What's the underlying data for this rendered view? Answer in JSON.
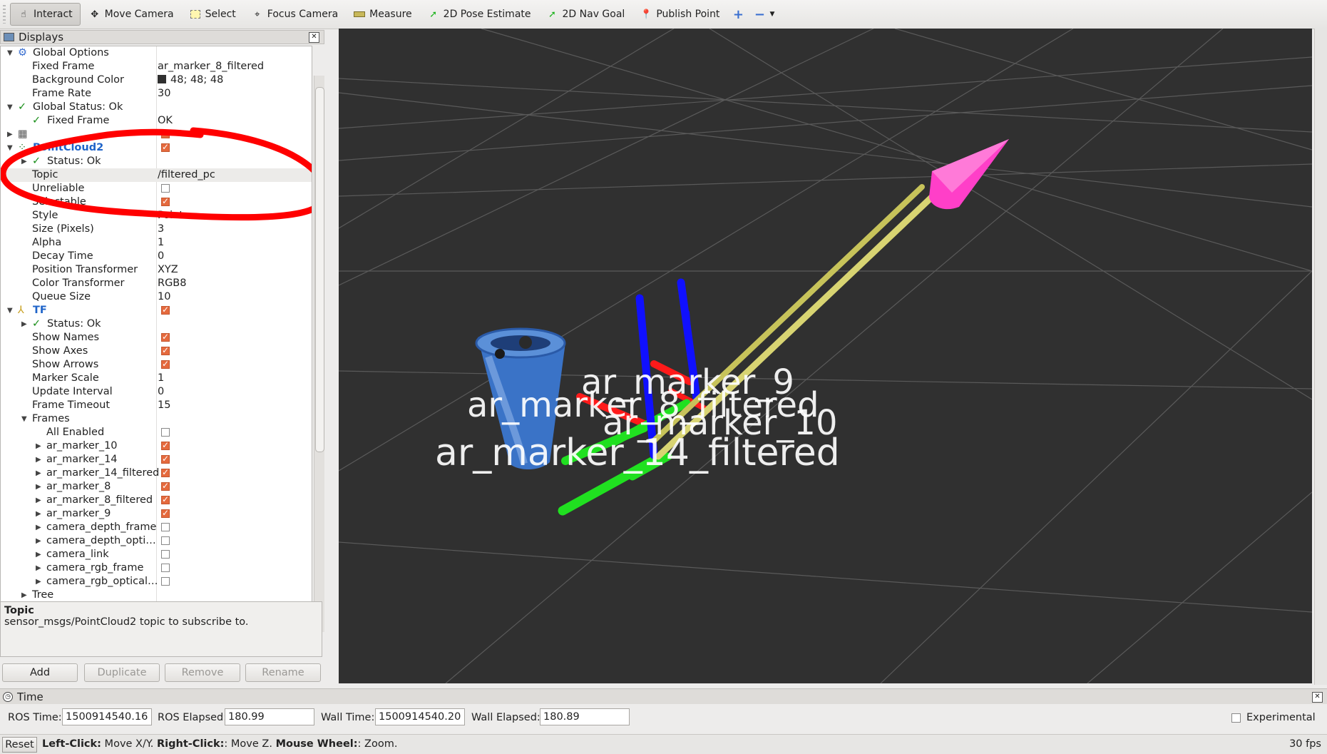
{
  "toolbar": {
    "interact": "Interact",
    "move_camera": "Move Camera",
    "select": "Select",
    "focus_camera": "Focus Camera",
    "measure": "Measure",
    "pose_estimate": "2D Pose Estimate",
    "nav_goal": "2D Nav Goal",
    "publish_point": "Publish Point"
  },
  "displays": {
    "title": "Displays",
    "rows": {
      "global_options": "Global Options",
      "fixed_frame_label": "Fixed Frame",
      "fixed_frame_value": "ar_marker_8_filtered",
      "bg_color_label": "Background Color",
      "bg_color_value": "48; 48; 48",
      "frame_rate_label": "Frame Rate",
      "frame_rate_value": "30",
      "global_status": "Global Status: Ok",
      "gs_fixed_frame": "Fixed Frame",
      "gs_fixed_frame_value": "OK",
      "pointcloud2": "PointCloud2",
      "pc_status": "Status: Ok",
      "topic_label": "Topic",
      "topic_value": "/filtered_pc",
      "unreliable_label": "Unreliable",
      "selectable_label": "Selectable",
      "style_label": "Style",
      "style_value": "Points",
      "size_label": "Size (Pixels)",
      "size_value": "3",
      "alpha_label": "Alpha",
      "alpha_value": "1",
      "decay_label": "Decay Time",
      "decay_value": "0",
      "pos_tf_label": "Position Transformer",
      "pos_tf_value": "XYZ",
      "color_tf_label": "Color Transformer",
      "color_tf_value": "RGB8",
      "queue_label": "Queue Size",
      "queue_value": "10",
      "tf": "TF",
      "tf_status": "Status: Ok",
      "show_names": "Show Names",
      "show_axes": "Show Axes",
      "show_arrows": "Show Arrows",
      "marker_scale_label": "Marker Scale",
      "marker_scale_value": "1",
      "update_interval_label": "Update Interval",
      "update_interval_value": "0",
      "frame_timeout_label": "Frame Timeout",
      "frame_timeout_value": "15",
      "frames": "Frames",
      "all_enabled": "All Enabled",
      "tree": "Tree"
    },
    "frames": [
      {
        "name": "ar_marker_10",
        "on": true
      },
      {
        "name": "ar_marker_14",
        "on": true
      },
      {
        "name": "ar_marker_14_filtered",
        "on": true
      },
      {
        "name": "ar_marker_8",
        "on": true
      },
      {
        "name": "ar_marker_8_filtered",
        "on": true
      },
      {
        "name": "ar_marker_9",
        "on": true
      },
      {
        "name": "camera_depth_frame",
        "on": false
      },
      {
        "name": "camera_depth_opti…",
        "on": false
      },
      {
        "name": "camera_link",
        "on": false
      },
      {
        "name": "camera_rgb_frame",
        "on": false
      },
      {
        "name": "camera_rgb_optical…",
        "on": false
      }
    ]
  },
  "description": {
    "title": "Topic",
    "text": "sensor_msgs/PointCloud2 topic to subscribe to."
  },
  "buttons": {
    "add": "Add",
    "duplicate": "Duplicate",
    "remove": "Remove",
    "rename": "Rename"
  },
  "viewport": {
    "labels": [
      "ar_marker_9",
      "ar_marker_8_filtered",
      "ar_marker_10",
      "ar_marker_14_filtered"
    ],
    "colors": {
      "background": "#303030",
      "x_axis": "#ff0000",
      "y_axis": "#00ff00",
      "z_axis": "#0000ff",
      "arrow": "#d4d060",
      "arrow_head": "#ff3fc8",
      "annotation": "#ff0000"
    }
  },
  "time": {
    "title": "Time",
    "ros_time_label": "ROS Time:",
    "ros_time_value": "1500914540.16",
    "ros_elapsed_label": "ROS Elapsed:",
    "ros_elapsed_value": "180.99",
    "wall_time_label": "Wall Time:",
    "wall_time_value": "1500914540.20",
    "wall_elapsed_label": "Wall Elapsed:",
    "wall_elapsed_value": "180.89",
    "experimental": "Experimental"
  },
  "status": {
    "reset": "Reset",
    "left_click": "Left-Click:",
    "left_click_desc": " Move X/Y. ",
    "right_click": "Right-Click:",
    "right_click_desc": ": Move Z. ",
    "wheel": "Mouse Wheel:",
    "wheel_desc": ": Zoom.",
    "fps": "30 fps"
  }
}
